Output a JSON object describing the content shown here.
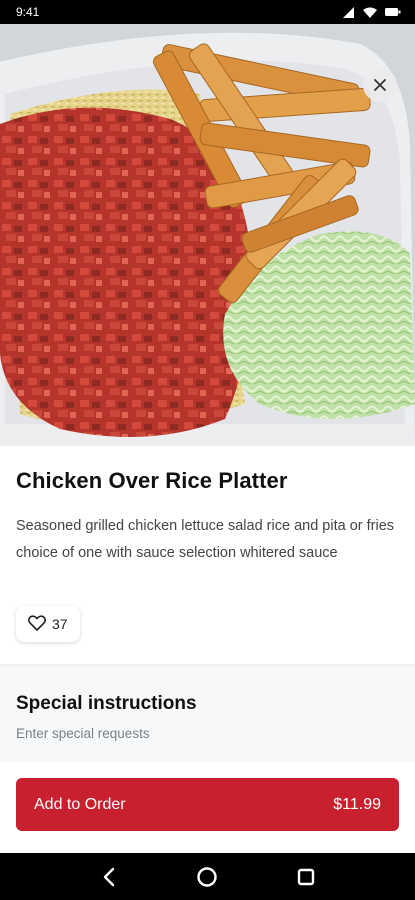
{
  "status_bar": {
    "time": "9:41"
  },
  "item": {
    "title": "Chicken Over Rice Platter",
    "description": "Seasoned grilled chicken lettuce salad rice and pita or fries choice of one with sauce selection whitered sauce",
    "likes": "37"
  },
  "special_instructions": {
    "title": "Special instructions",
    "placeholder": "Enter special requests"
  },
  "order_button": {
    "label": "Add to Order",
    "price": "$11.99"
  },
  "colors": {
    "accent": "#c8202e"
  },
  "icons": [
    "signal-icon",
    "wifi-icon",
    "battery-icon",
    "close-icon",
    "heart-icon",
    "back-icon",
    "home-icon",
    "recents-icon"
  ]
}
